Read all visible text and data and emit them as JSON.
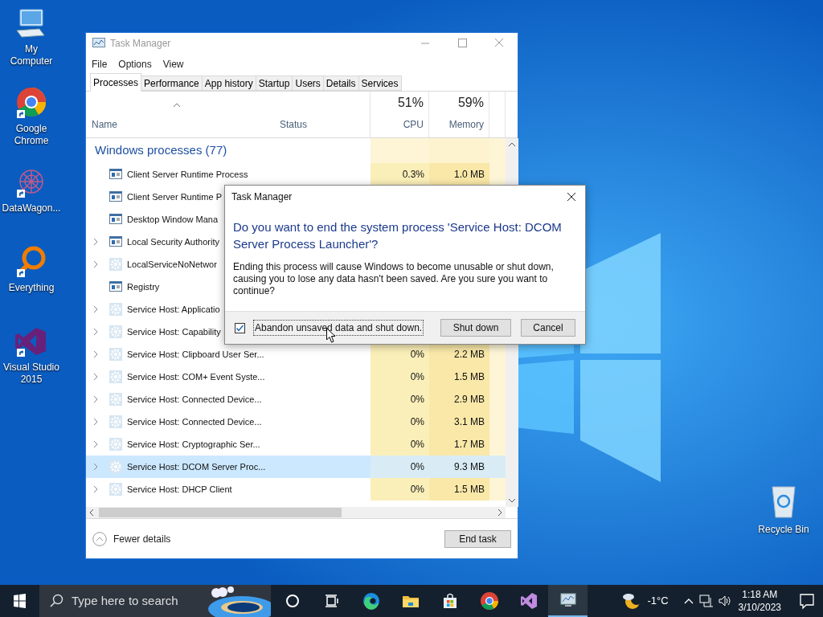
{
  "desktop_icons": [
    {
      "label": "My Computer",
      "kind": "computer",
      "shortcut": false
    },
    {
      "label": "Google Chrome",
      "kind": "chrome",
      "shortcut": true
    },
    {
      "label": "DataWagon...",
      "kind": "datawagon",
      "shortcut": true
    },
    {
      "label": "Everything",
      "kind": "everything",
      "shortcut": true
    },
    {
      "label": "Visual Studio 2015",
      "kind": "visualstudio",
      "shortcut": true
    }
  ],
  "recycle_bin": {
    "label": "Recycle Bin"
  },
  "task_manager": {
    "title": "Task Manager",
    "menu": [
      "File",
      "Options",
      "View"
    ],
    "tabs": [
      {
        "label": "Processes",
        "selected": true
      },
      {
        "label": "Performance",
        "selected": false
      },
      {
        "label": "App history",
        "selected": false
      },
      {
        "label": "Startup",
        "selected": false
      },
      {
        "label": "Users",
        "selected": false
      },
      {
        "label": "Details",
        "selected": false
      },
      {
        "label": "Services",
        "selected": false
      }
    ],
    "columns": {
      "name": "Name",
      "status": "Status",
      "cpu": {
        "percent": "51%",
        "label": "CPU"
      },
      "memory": {
        "percent": "59%",
        "label": "Memory"
      }
    },
    "group": "Windows processes (77)",
    "rows": [
      {
        "name": "Client Server Runtime Process",
        "kind": "window",
        "expandable": false,
        "cpu": "0.3%",
        "memory": "1.0 MB",
        "selected": false
      },
      {
        "name": "Client Server Runtime P",
        "kind": "window",
        "expandable": false,
        "selected": false
      },
      {
        "name": "Desktop Window Mana",
        "kind": "window",
        "expandable": false,
        "selected": false
      },
      {
        "name": "Local Security Authority",
        "kind": "window",
        "expandable": true,
        "selected": false
      },
      {
        "name": "LocalServiceNoNetwor",
        "kind": "gear",
        "expandable": true,
        "selected": false
      },
      {
        "name": "Registry",
        "kind": "window",
        "expandable": false,
        "selected": false
      },
      {
        "name": "Service Host: Applicatio",
        "kind": "gear",
        "expandable": true,
        "selected": false
      },
      {
        "name": "Service Host: Capability",
        "kind": "gear",
        "expandable": true,
        "selected": false
      },
      {
        "name": "Service Host: Clipboard User Ser...",
        "kind": "gear",
        "expandable": true,
        "cpu": "0%",
        "memory": "2.2 MB",
        "selected": false
      },
      {
        "name": "Service Host: COM+ Event Syste...",
        "kind": "gear",
        "expandable": true,
        "cpu": "0%",
        "memory": "1.5 MB",
        "selected": false
      },
      {
        "name": "Service Host: Connected Device...",
        "kind": "gear",
        "expandable": true,
        "cpu": "0%",
        "memory": "2.9 MB",
        "selected": false
      },
      {
        "name": "Service Host: Connected Device...",
        "kind": "gear",
        "expandable": true,
        "cpu": "0%",
        "memory": "3.1 MB",
        "selected": false
      },
      {
        "name": "Service Host: Cryptographic Ser...",
        "kind": "gear",
        "expandable": true,
        "cpu": "0%",
        "memory": "1.7 MB",
        "selected": false
      },
      {
        "name": "Service Host: DCOM Server Proc...",
        "kind": "gear",
        "expandable": true,
        "cpu": "0%",
        "memory": "9.3 MB",
        "selected": true
      },
      {
        "name": "Service Host: DHCP Client",
        "kind": "gear",
        "expandable": true,
        "cpu": "0%",
        "memory": "1.5 MB",
        "selected": false
      }
    ],
    "fewer_details": "Fewer details",
    "end_task": "End task"
  },
  "dialog": {
    "title": "Task Manager",
    "heading": "Do you want to end the system process 'Service Host: DCOM Server Process Launcher'?",
    "body": "Ending this process will cause Windows to become unusable or shut down, causing you to lose any data hasn't been saved. Are you sure you want to continue?",
    "checkbox": {
      "label": "Abandon unsaved data and shut down.",
      "checked": true
    },
    "buttons": [
      "Shut down",
      "Cancel"
    ]
  },
  "taskbar": {
    "search_placeholder": "Type here to search",
    "apps": [
      {
        "kind": "cortana",
        "active": false
      },
      {
        "kind": "taskview",
        "active": false
      },
      {
        "kind": "edge",
        "active": false
      },
      {
        "kind": "explorer",
        "active": false
      },
      {
        "kind": "store",
        "active": false
      },
      {
        "kind": "chrome",
        "active": false
      },
      {
        "kind": "visualstudio",
        "active": false
      },
      {
        "kind": "taskmanager",
        "active": true
      }
    ],
    "temperature": "-1°C",
    "time": "1:18 AM",
    "date": "3/10/2023"
  }
}
